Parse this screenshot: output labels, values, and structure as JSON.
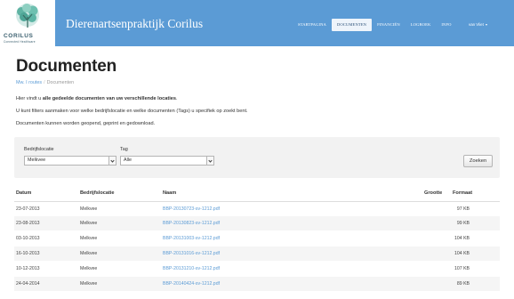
{
  "header": {
    "logo_text": "CORILUS",
    "logo_tagline": "Connected Healthcare",
    "site_title": "Dierenartsenpraktijk Corilus",
    "nav": [
      {
        "label": "STARTPAGINA"
      },
      {
        "label": "DOCUMENTEN",
        "active": true
      },
      {
        "label": "FINANCIËN"
      },
      {
        "label": "LOGBOEK"
      },
      {
        "label": "INFO"
      }
    ],
    "user": "van Vliet"
  },
  "page": {
    "title": "Documenten",
    "breadcrumb": [
      "Mw. I routes",
      "Documenten"
    ],
    "intro": {
      "line1_pre": "Hier vindt u ",
      "line1_bold": "alle gedeelde documenten van uw verschillende locaties",
      "line1_post": ".",
      "line2": "U kunt filters aanmaken voor welke bedrijfslocatie en welke documenten (Tags) u specifiek op zoekt bent.",
      "line3": "Documenten kunnen worden geopend, geprint en gedownload."
    }
  },
  "filter": {
    "location_label": "Bedrijfslocatie",
    "location_value": "Melkvee",
    "tag_label": "Tag",
    "tag_value": "Alle",
    "search_button": "Zoeken"
  },
  "table": {
    "columns": [
      "Datum",
      "Bedrijfslocatie",
      "Naam",
      "Grootte",
      "Formaat"
    ],
    "rows": [
      {
        "date": "23-07-2013",
        "location": "Melkvee",
        "name": "BBP-20130723-sv-1212.pdf",
        "size": "97 KB"
      },
      {
        "date": "23-08-2013",
        "location": "Melkvee",
        "name": "BBP-20130823-sv-1212.pdf",
        "size": "99 KB"
      },
      {
        "date": "03-10-2013",
        "location": "Melkvee",
        "name": "BBP-20131003-sv-1212.pdf",
        "size": "104 KB"
      },
      {
        "date": "16-10-2013",
        "location": "Melkvee",
        "name": "BBP-20131016-sv-1212.pdf",
        "size": "104 KB"
      },
      {
        "date": "10-12-2013",
        "location": "Melkvee",
        "name": "BBP-20131210-sv-1212.pdf",
        "size": "107 KB"
      },
      {
        "date": "24-04-2014",
        "location": "Melkvee",
        "name": "BBP-20140424-sv-1212.pdf",
        "size": "89 KB"
      }
    ]
  }
}
